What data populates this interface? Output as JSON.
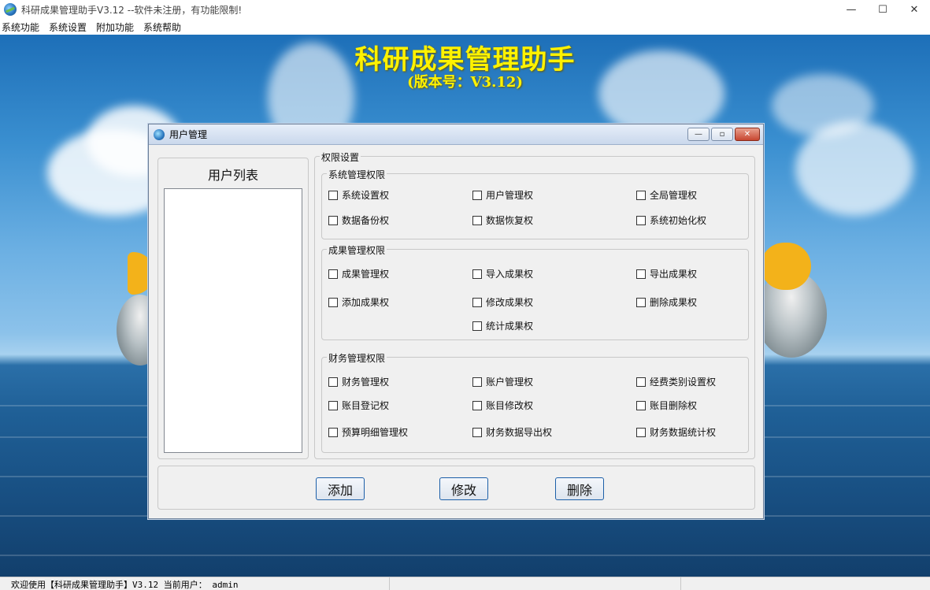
{
  "window": {
    "title": "科研成果管理助手V3.12 --软件未注册，有功能限制!",
    "minimize": "—",
    "maximize": "☐",
    "close": "✕"
  },
  "menu": [
    "系统功能",
    "系统设置",
    "附加功能",
    "系统帮助"
  ],
  "banner": {
    "title": "科研成果管理助手",
    "version": "(版本号：V3.12)"
  },
  "dialog": {
    "title": "用户管理",
    "ctrl_min": "—",
    "ctrl_max": "▫",
    "ctrl_close": "✕",
    "user_list_title": "用户列表",
    "perm_title": "权限设置",
    "groups": {
      "system": {
        "title": "系统管理权限",
        "items": [
          "系统设置权",
          "用户管理权",
          "全局管理权",
          "数据备份权",
          "数据恢复权",
          "系统初始化权"
        ]
      },
      "results": {
        "title": "成果管理权限",
        "items": [
          "成果管理权",
          "导入成果权",
          "导出成果权",
          "添加成果权",
          "修改成果权",
          "删除成果权",
          "统计成果权"
        ]
      },
      "finance": {
        "title": "财务管理权限",
        "items": [
          "财务管理权",
          "账户管理权",
          "经费类别设置权",
          "账目登记权",
          "账目修改权",
          "账目删除权",
          "预算明细管理权",
          "财务数据导出权",
          "财务数据统计权"
        ]
      }
    },
    "buttons": {
      "add": "添加",
      "edit": "修改",
      "delete": "删除"
    }
  },
  "status": {
    "welcome": "欢迎使用【科研成果管理助手】V3.12  当前用户： admin"
  }
}
